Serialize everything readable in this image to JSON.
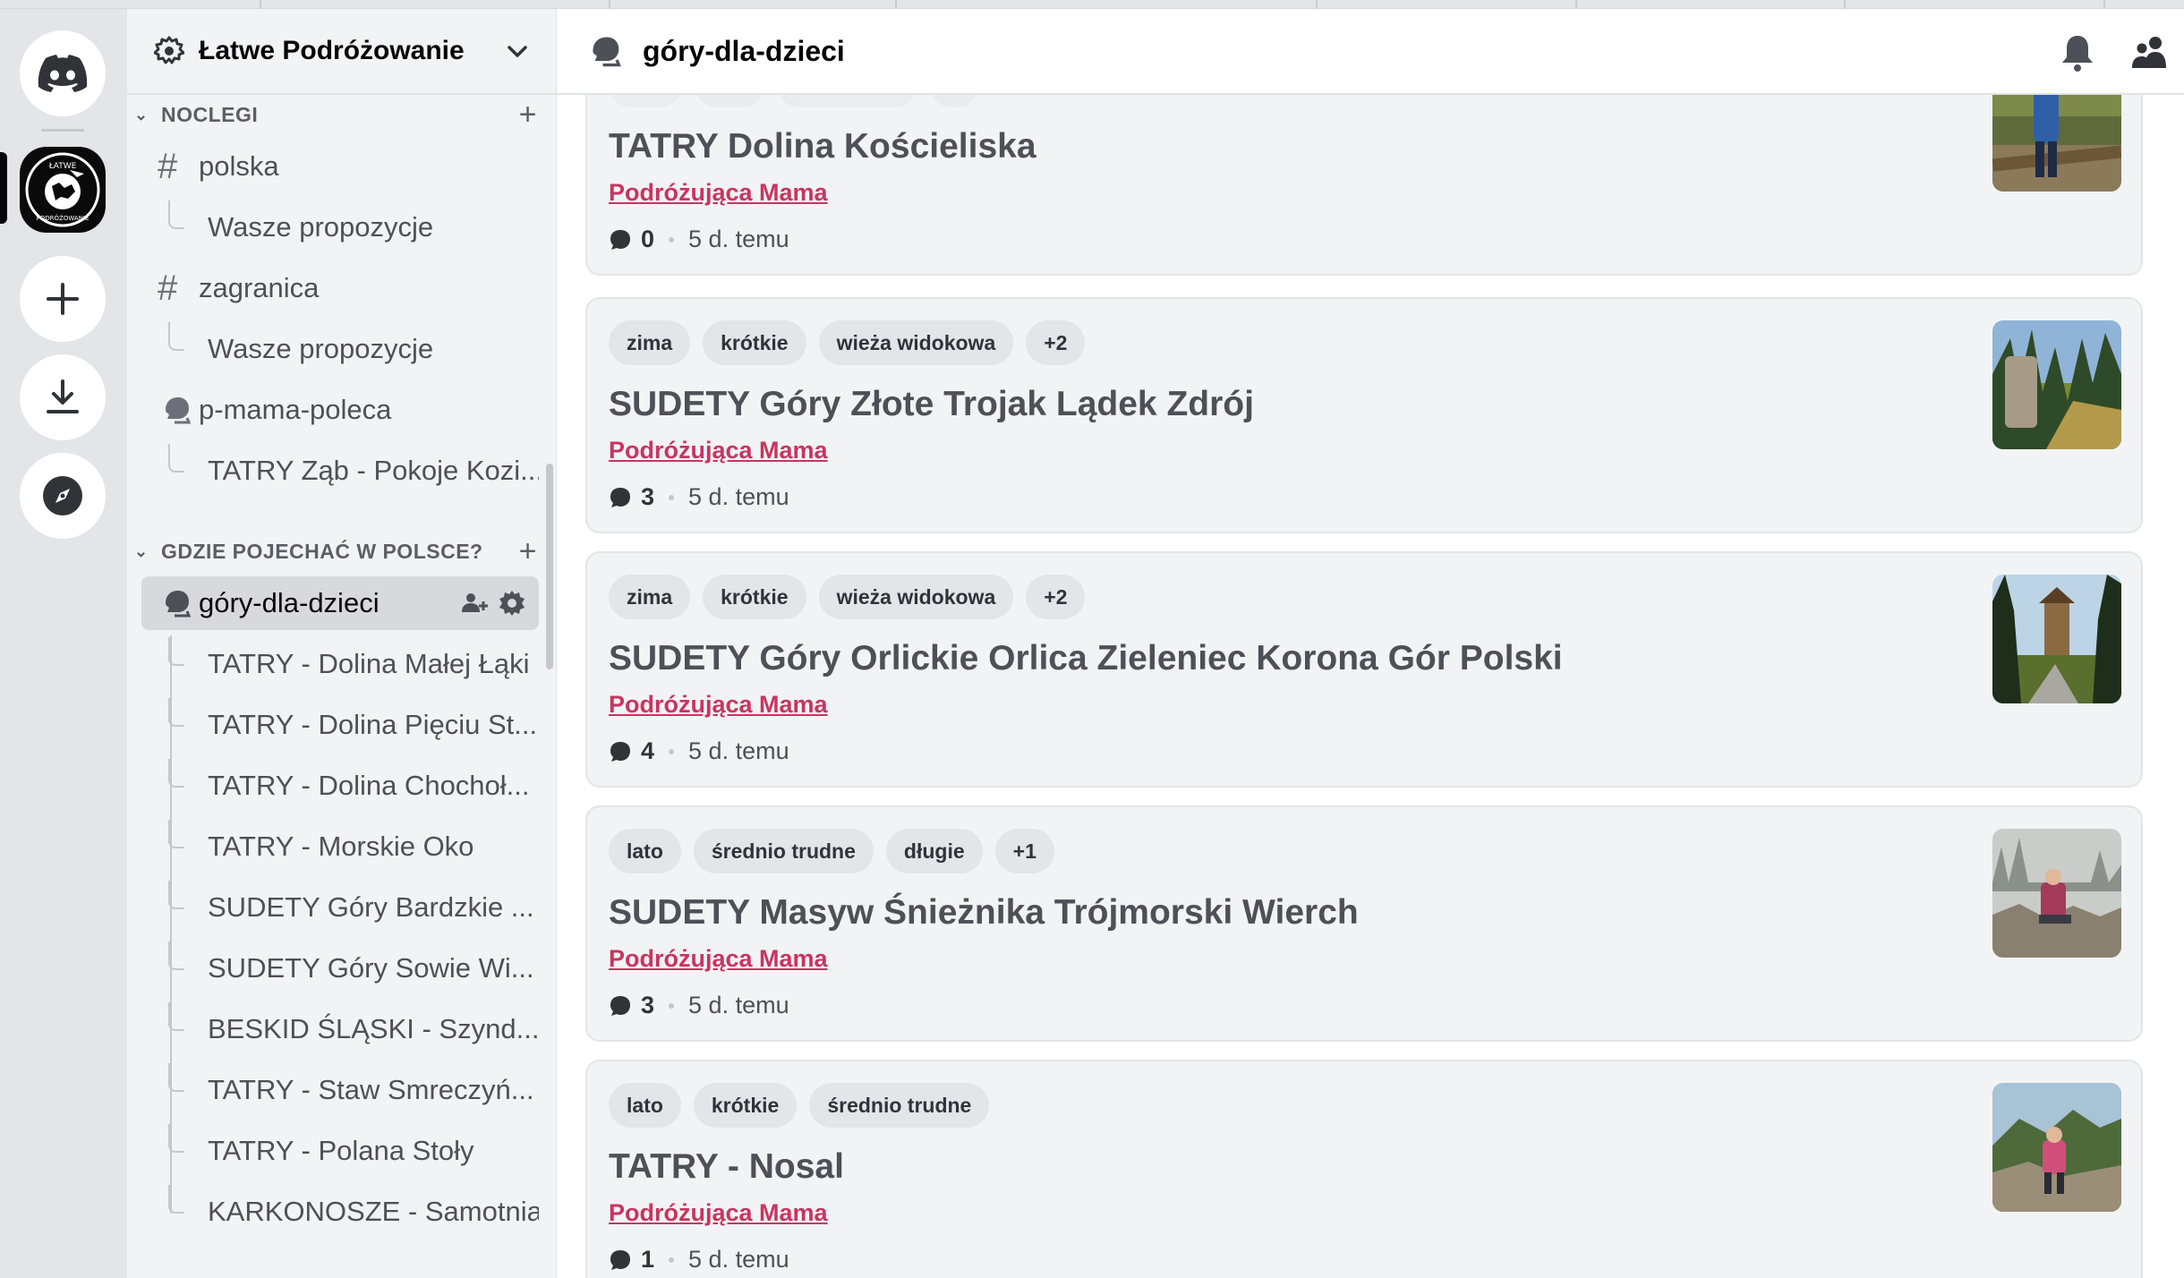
{
  "server": {
    "name": "Łatwe Podróżowanie"
  },
  "sidebar": {
    "categories": [
      {
        "label": "NOCLEGI"
      },
      {
        "label": "GDZIE POJECHAĆ W POLSCE?"
      }
    ],
    "channels": [
      {
        "label": "polska"
      },
      {
        "label": "Wasze propozycje"
      },
      {
        "label": "zagranica"
      },
      {
        "label": "Wasze propozycje"
      },
      {
        "label": "p-mama-poleca"
      },
      {
        "label": "TATRY Ząb - Pokoje Kozi..."
      },
      {
        "label": "góry-dla-dzieci"
      }
    ],
    "threads": [
      "TATRY - Dolina Małej Łąki",
      "TATRY - Dolina Pięciu St...",
      "TATRY - Dolina Chochoł...",
      "TATRY - Morskie Oko",
      "SUDETY Góry Bardzkie ...",
      "SUDETY Góry Sowie Wi...",
      "BESKID ŚLĄSKI - Szynd...",
      "TATRY - Staw Smreczyń...",
      "TATRY - Polana Stoły",
      "KARKONOSZE - Samotnia"
    ]
  },
  "header": {
    "title": "góry-dla-dzieci"
  },
  "posts": [
    {
      "tags": [],
      "title": "TATRY Dolina Kościeliska",
      "author": "Podróżująca Mama",
      "comments": "0",
      "time": "5 d. temu"
    },
    {
      "tags": [
        "zima",
        "krótkie",
        "wieża widokowa",
        "+2"
      ],
      "title": "SUDETY Góry Złote Trojak Lądek Zdrój",
      "author": "Podróżująca Mama",
      "comments": "3",
      "time": "5 d. temu"
    },
    {
      "tags": [
        "zima",
        "krótkie",
        "wieża widokowa",
        "+2"
      ],
      "title": "SUDETY Góry Orlickie Orlica Zieleniec Korona Gór Polski",
      "author": "Podróżująca Mama",
      "comments": "4",
      "time": "5 d. temu"
    },
    {
      "tags": [
        "lato",
        "średnio trudne",
        "długie",
        "+1"
      ],
      "title": "SUDETY Masyw Śnieżnika Trójmorski Wierch",
      "author": "Podróżująca Mama",
      "comments": "3",
      "time": "5 d. temu"
    },
    {
      "tags": [
        "lato",
        "krótkie",
        "średnio trudne"
      ],
      "title": "TATRY - Nosal",
      "author": "Podróżująca Mama",
      "comments": "1",
      "time": "5 d. temu"
    }
  ],
  "colors": {
    "accent": "#c8355f",
    "active_bg": "#d7d9dc"
  }
}
